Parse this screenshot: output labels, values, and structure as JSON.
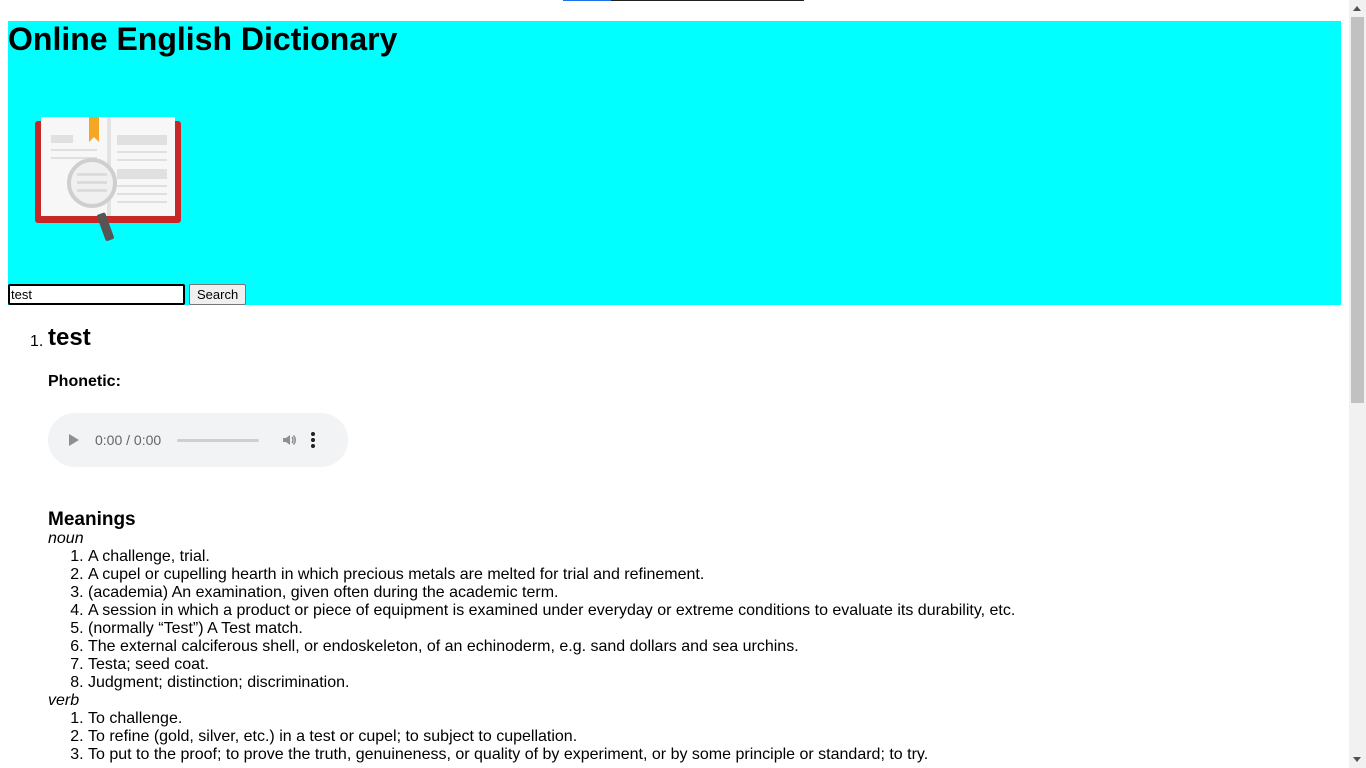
{
  "header": {
    "title": "Online English Dictionary",
    "logo_icon": "open-book-magnifier-icon"
  },
  "search": {
    "value": "test",
    "button_label": "Search"
  },
  "entry": {
    "number": "1.",
    "word": "test",
    "phonetic_label": "Phonetic:",
    "audio": {
      "time": "0:00 / 0:00"
    },
    "meanings_label": "Meanings",
    "noun_label": "noun",
    "noun_defs": [
      "A challenge, trial.",
      "A cupel or cupelling hearth in which precious metals are melted for trial and refinement.",
      "(academia) An examination, given often during the academic term.",
      "A session in which a product or piece of equipment is examined under everyday or extreme conditions to evaluate its durability, etc.",
      "(normally “Test”) A Test match.",
      "The external calciferous shell, or endoskeleton, of an echinoderm, e.g. sand dollars and sea urchins.",
      "Testa; seed coat.",
      "Judgment; distinction; discrimination."
    ],
    "verb_label": "verb",
    "verb_defs": [
      "To challenge.",
      "To refine (gold, silver, etc.) in a test or cupel; to subject to cupellation.",
      "To put to the proof; to prove the truth, genuineness, or quality of by experiment, or by some principle or standard; to try."
    ]
  },
  "colors": {
    "header_bg": "#00ffff",
    "book_cover": "#d32f2f",
    "bookmark": "#f5a623"
  }
}
